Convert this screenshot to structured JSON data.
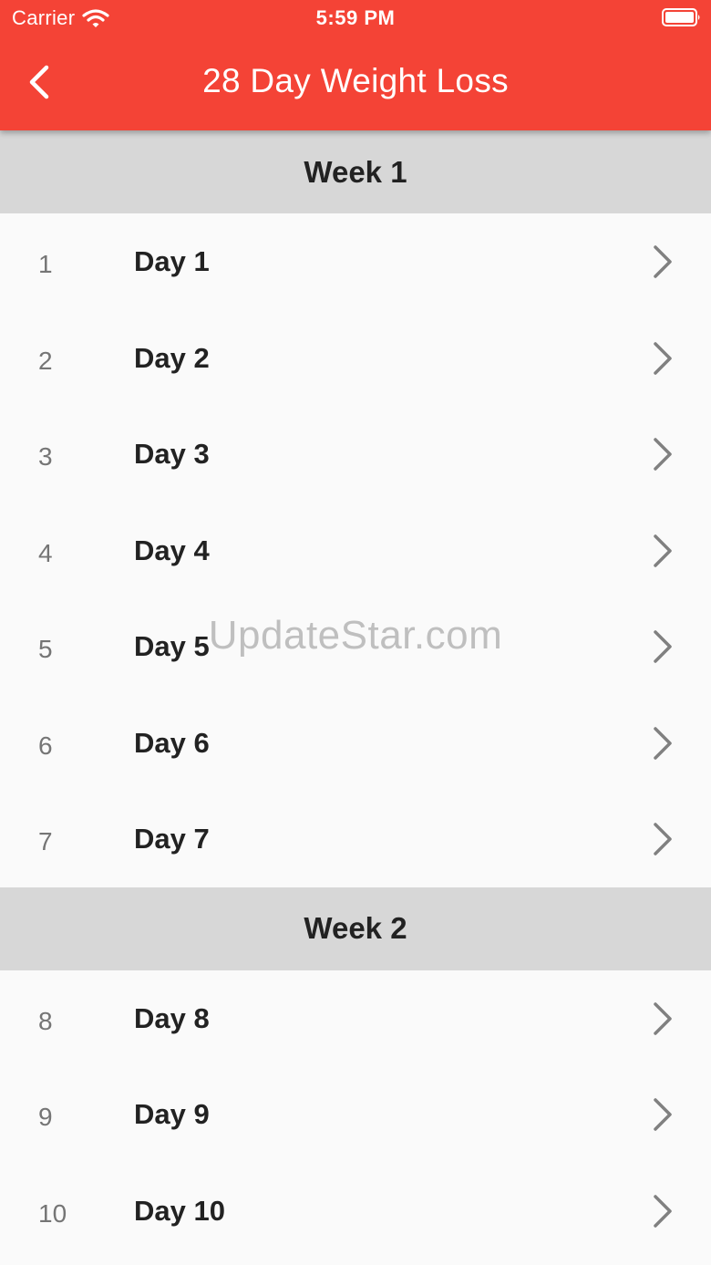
{
  "status_bar": {
    "carrier": "Carrier",
    "time": "5:59 PM"
  },
  "app_bar": {
    "title": "28 Day Weight Loss",
    "background_color": "#f44336",
    "back_icon": "chevron-left-icon"
  },
  "weeks": [
    {
      "label": "Week 1",
      "days": [
        {
          "number": "1",
          "label": "Day 1"
        },
        {
          "number": "2",
          "label": "Day 2"
        },
        {
          "number": "3",
          "label": "Day 3"
        },
        {
          "number": "4",
          "label": "Day 4"
        },
        {
          "number": "5",
          "label": "Day 5"
        },
        {
          "number": "6",
          "label": "Day 6"
        },
        {
          "number": "7",
          "label": "Day 7"
        }
      ]
    },
    {
      "label": "Week 2",
      "days": [
        {
          "number": "8",
          "label": "Day 8"
        },
        {
          "number": "9",
          "label": "Day 9"
        },
        {
          "number": "10",
          "label": "Day 10"
        }
      ]
    }
  ],
  "watermark": "UpdateStar.com",
  "colors": {
    "week_header_bg": "#d7d7d7",
    "row_bg": "#fafafa",
    "chevron": "#808080"
  }
}
